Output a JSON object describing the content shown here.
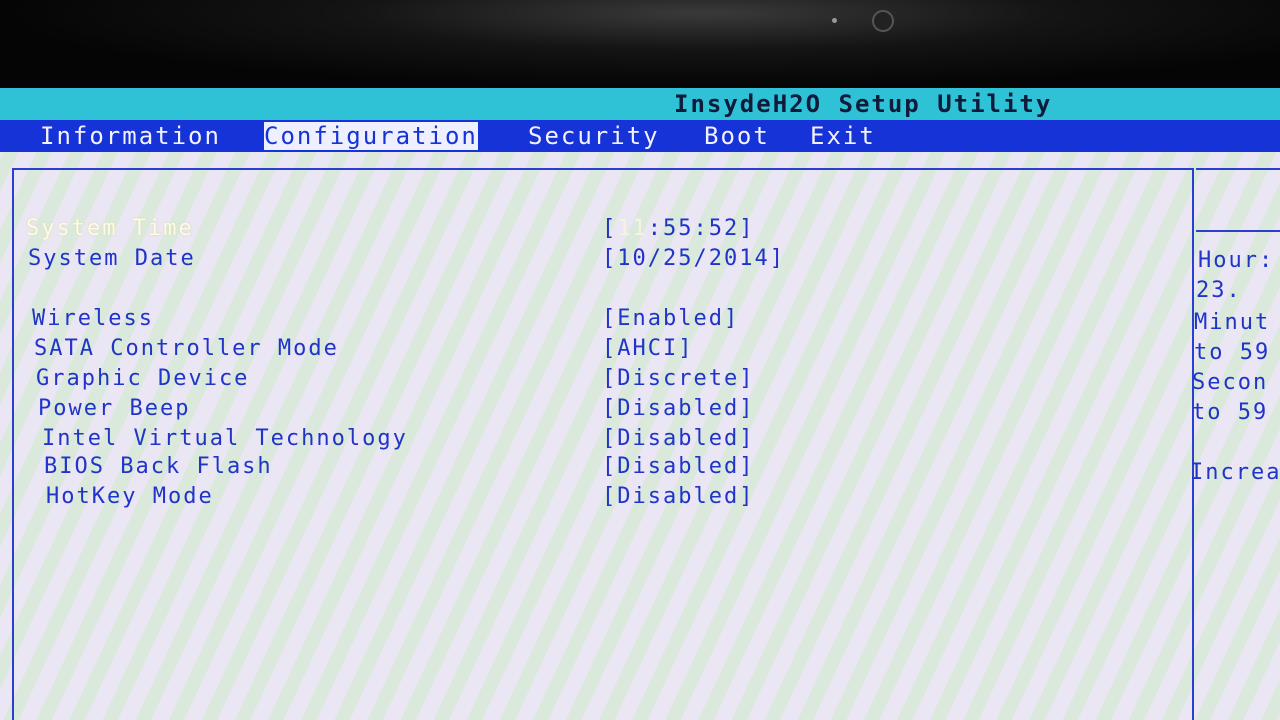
{
  "title": "InsydeH2O Setup Utility",
  "menu": [
    "Information",
    "Configuration",
    "Security",
    "Boot",
    "Exit"
  ],
  "active_menu": "Configuration",
  "settings": [
    {
      "label": "System Time",
      "value_prefix": "[",
      "value_hour": "11",
      "value_rest": ":55:52]"
    },
    {
      "label": "System Date",
      "value": "[10/25/2014]"
    },
    {
      "label": "Wireless",
      "value": "[Enabled]"
    },
    {
      "label": "SATA Controller Mode",
      "value": "[AHCI]"
    },
    {
      "label": "Graphic Device",
      "value": "[Discrete]"
    },
    {
      "label": "Power Beep",
      "value": "[Disabled]"
    },
    {
      "label": "Intel Virtual Technology",
      "value": "[Disabled]"
    },
    {
      "label": "BIOS Back Flash",
      "value": "[Disabled]"
    },
    {
      "label": "HotKey Mode",
      "value": "[Disabled]"
    }
  ],
  "help": [
    "Hour:",
    "23.",
    "Minut",
    "to 59",
    "Secon",
    "to 59",
    "Increa"
  ],
  "colors": {
    "title_bar": "#2fc1d6",
    "menu_bar": "#1533d6",
    "text": "#2035c8",
    "selected_text": "#fbfbe8"
  }
}
